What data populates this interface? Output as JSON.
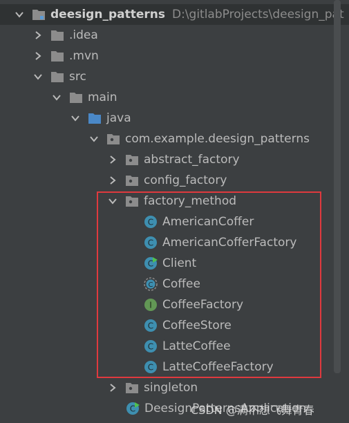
{
  "tree": {
    "root": {
      "label": "deesign_patterns",
      "path": "D:\\gitlabProjects\\deesign_pat"
    },
    "nodes": [
      {
        "label": ".idea"
      },
      {
        "label": ".mvn"
      },
      {
        "label": "src"
      },
      {
        "label": "main"
      },
      {
        "label": "java"
      },
      {
        "label": "com.example.deesign_patterns"
      },
      {
        "label": "abstract_factory"
      },
      {
        "label": "config_factory"
      },
      {
        "label": "factory_method"
      },
      {
        "label": "AmericanCoffer"
      },
      {
        "label": "AmericanCofferFactory"
      },
      {
        "label": "Client"
      },
      {
        "label": "Coffee"
      },
      {
        "label": "CoffeeFactory"
      },
      {
        "label": "CoffeeStore"
      },
      {
        "label": "LatteCoffee"
      },
      {
        "label": "LatteCoffeeFactory"
      },
      {
        "label": "singleton"
      },
      {
        "label": "DeesignPatternsApplication"
      }
    ]
  },
  "colors": {
    "background": "#3c3f41",
    "folder": "#8c8c8c",
    "source_folder": "#5b9bd5",
    "class_icon": "#3e8fb0",
    "interface_icon": "#629755",
    "highlight_border": "#e0393e"
  },
  "watermark": "CSDN @满不想飞舞青春"
}
